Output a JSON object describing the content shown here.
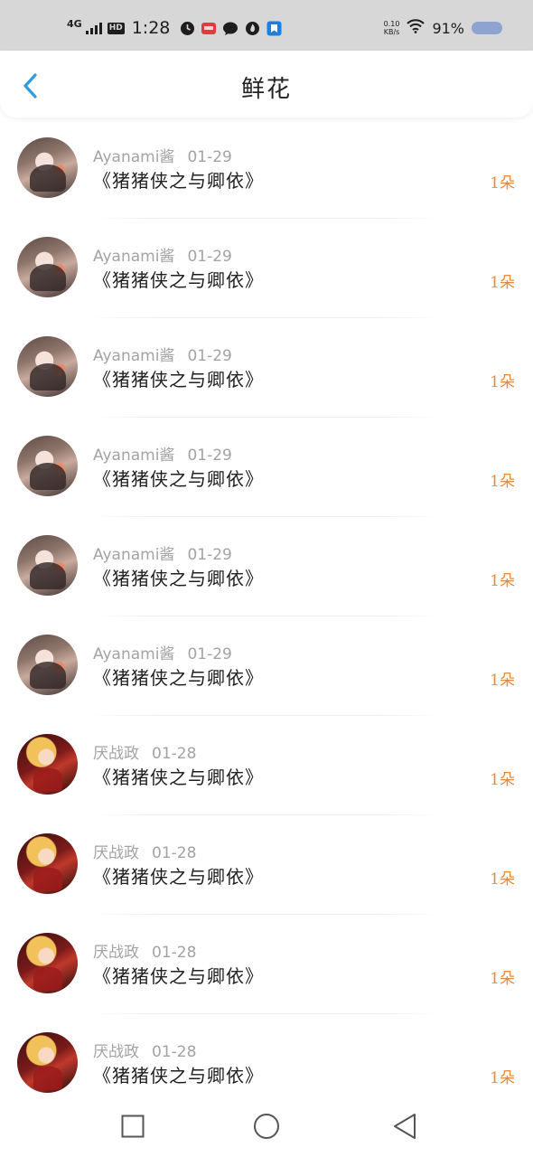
{
  "status_bar": {
    "network": "4G",
    "hd": "HD",
    "time": "1:28",
    "net_speed_value": "0.10",
    "net_speed_unit": "KB/s",
    "battery": "91%",
    "icons": [
      "alarm-icon",
      "app-notification-icon",
      "chat-bubble-icon",
      "flame-icon",
      "bookmark-app-icon",
      "wifi-icon",
      "battery-icon"
    ]
  },
  "header": {
    "title": "鲜花",
    "back_icon": "chevron-left-icon",
    "accent_color": "#2d9cdb"
  },
  "colors": {
    "count": "#e98a3a",
    "meta": "#a3a3a3",
    "book_title": "#1f1f1f"
  },
  "records": [
    {
      "user": "Ayanami酱",
      "date": "01-29",
      "book": "《猪猪侠之与卿依》",
      "count": "1朵"
    },
    {
      "user": "Ayanami酱",
      "date": "01-29",
      "book": "《猪猪侠之与卿依》",
      "count": "1朵"
    },
    {
      "user": "Ayanami酱",
      "date": "01-29",
      "book": "《猪猪侠之与卿依》",
      "count": "1朵"
    },
    {
      "user": "Ayanami酱",
      "date": "01-29",
      "book": "《猪猪侠之与卿依》",
      "count": "1朵"
    },
    {
      "user": "Ayanami酱",
      "date": "01-29",
      "book": "《猪猪侠之与卿依》",
      "count": "1朵"
    },
    {
      "user": "Ayanami酱",
      "date": "01-29",
      "book": "《猪猪侠之与卿依》",
      "count": "1朵"
    },
    {
      "user": "厌战政",
      "date": "01-28",
      "book": "《猪猪侠之与卿依》",
      "count": "1朵"
    },
    {
      "user": "厌战政",
      "date": "01-28",
      "book": "《猪猪侠之与卿依》",
      "count": "1朵"
    },
    {
      "user": "厌战政",
      "date": "01-28",
      "book": "《猪猪侠之与卿依》",
      "count": "1朵"
    },
    {
      "user": "厌战政",
      "date": "01-28",
      "book": "《猪猪侠之与卿依》",
      "count": "1朵"
    }
  ],
  "nav_bar": {
    "icons": [
      "recent-apps-icon",
      "home-icon",
      "back-triangle-icon"
    ]
  }
}
